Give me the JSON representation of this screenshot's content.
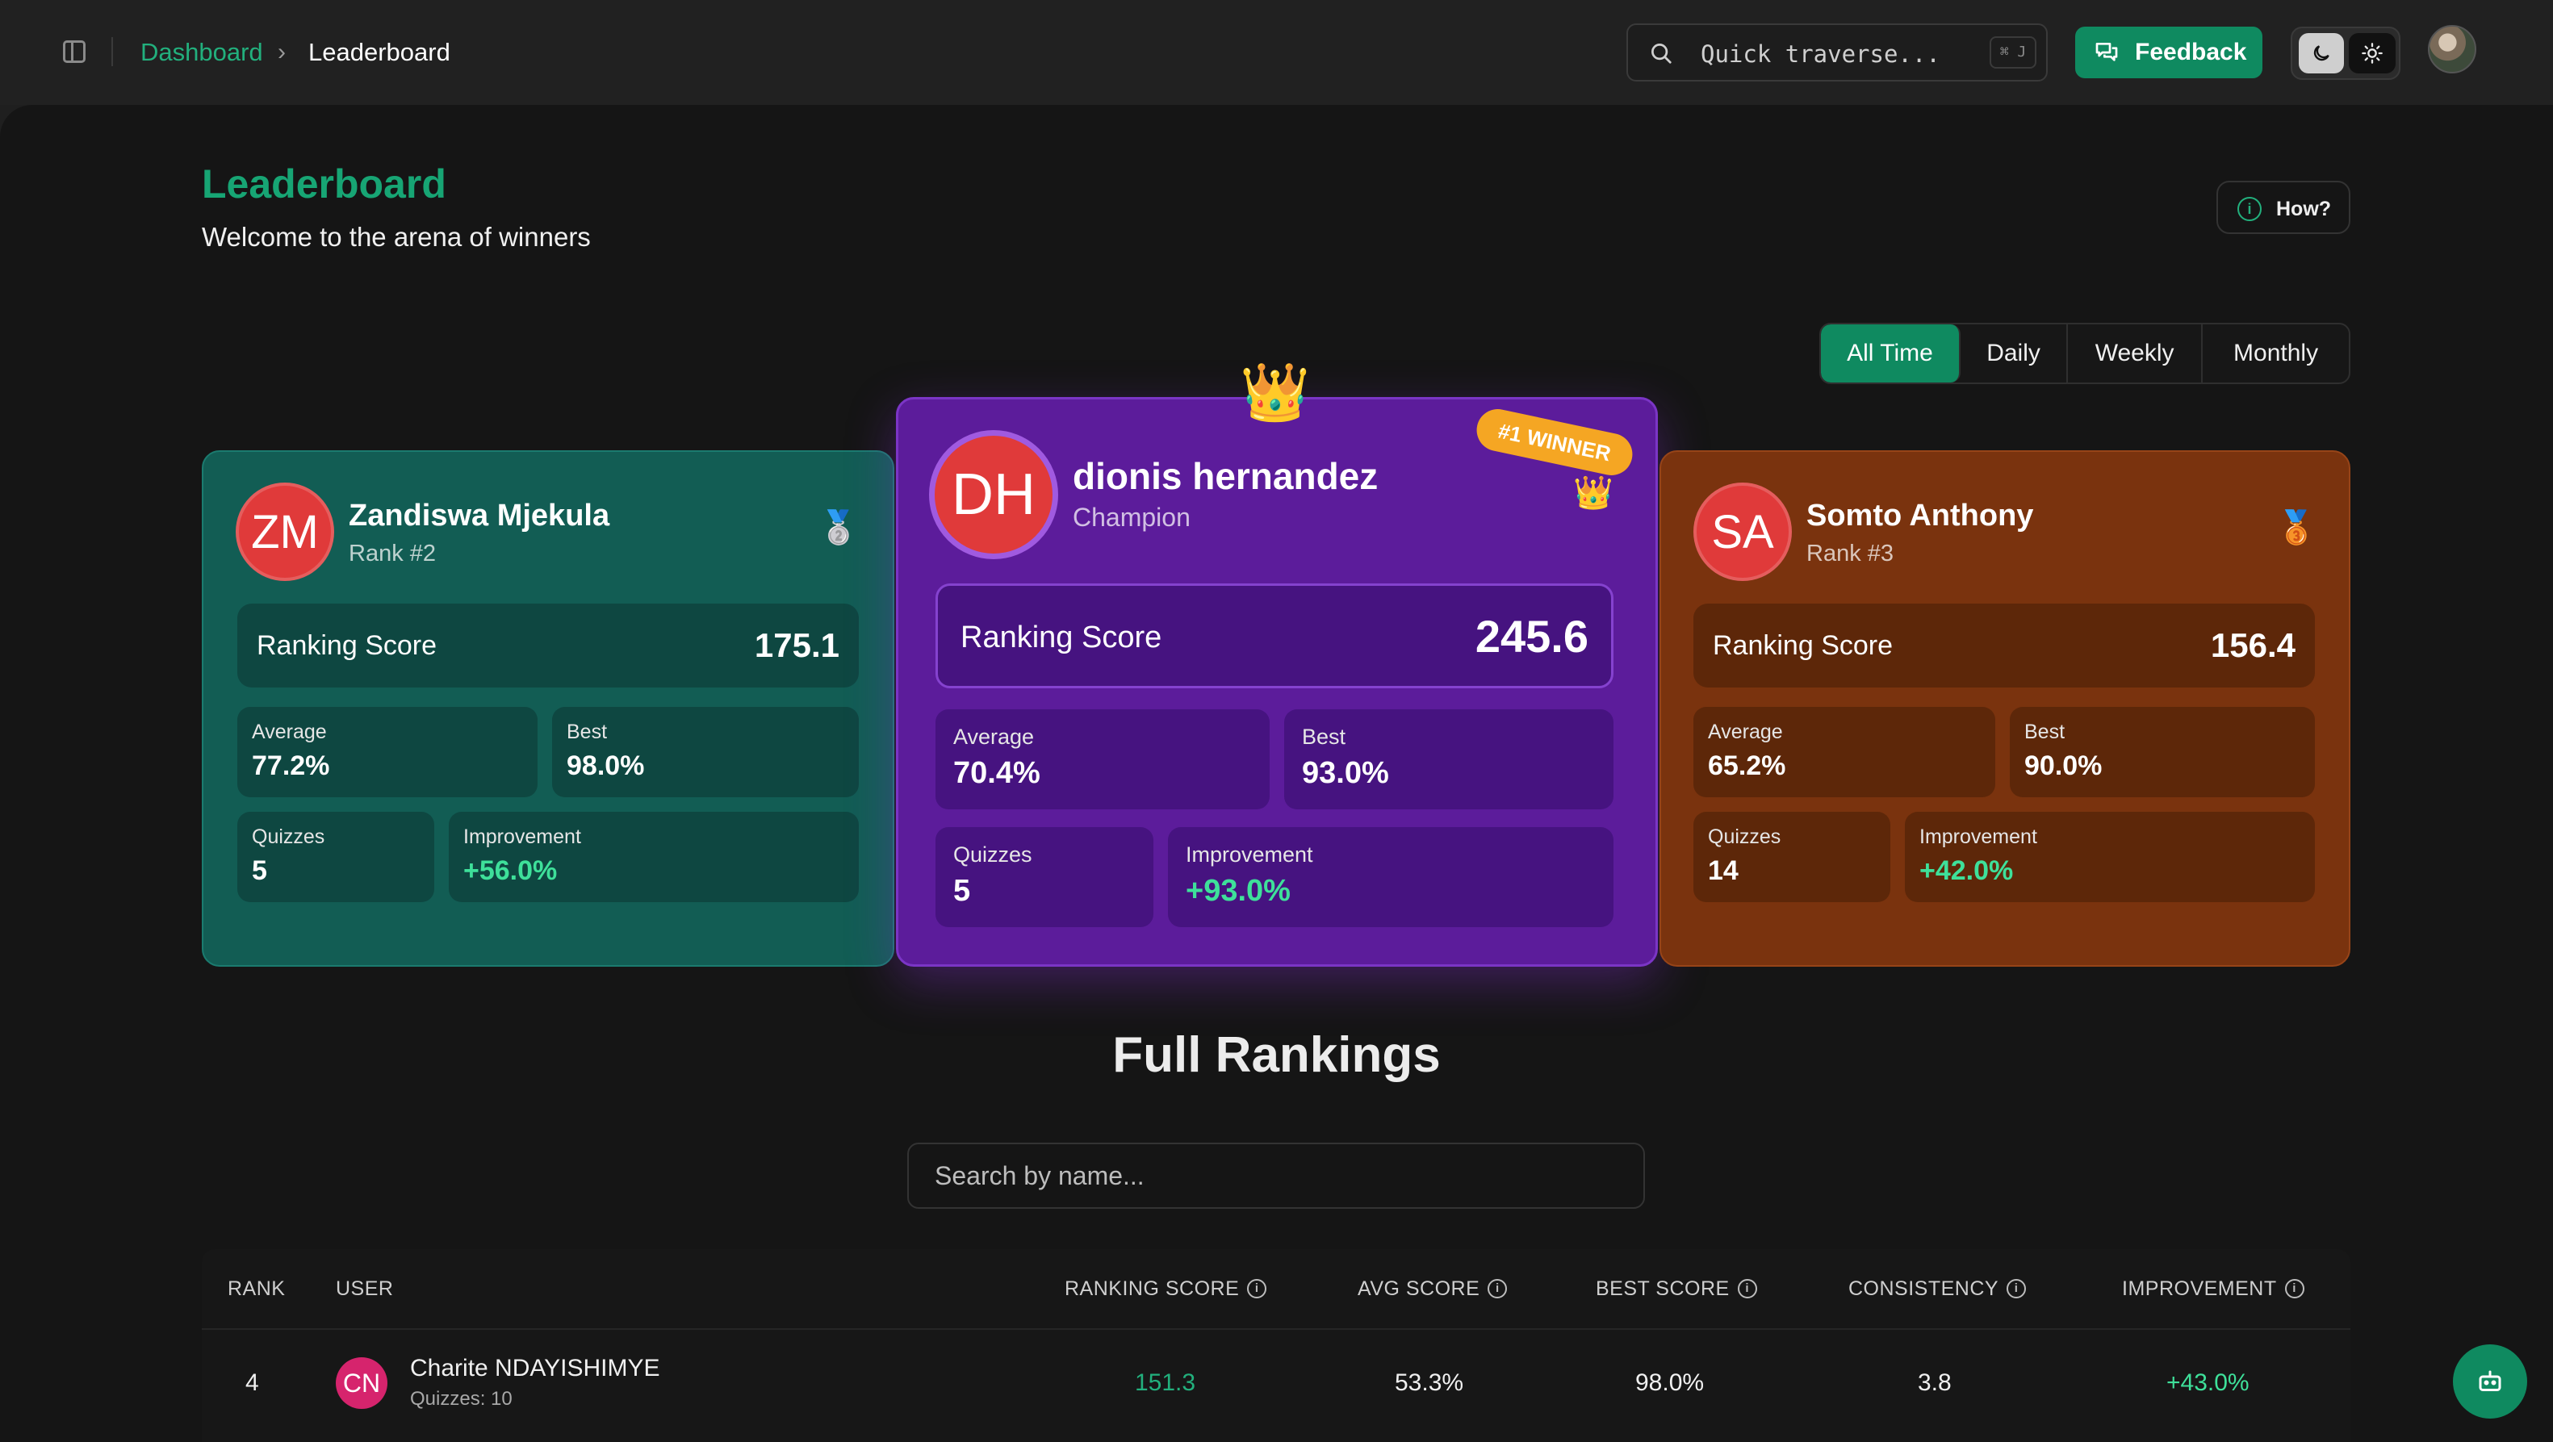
{
  "breadcrumb": {
    "parent": "Dashboard",
    "separator": ">",
    "current": "Leaderboard"
  },
  "search": {
    "placeholder": "Quick traverse...",
    "shortcut": "⌘ J"
  },
  "feedback": {
    "label": "Feedback"
  },
  "page": {
    "title": "Leaderboard",
    "subtitle": "Welcome to the arena of winners",
    "how_label": "How?"
  },
  "periods": [
    "All Time",
    "Daily",
    "Weekly",
    "Monthly"
  ],
  "active_period": "All Time",
  "podium": {
    "first": {
      "initials": "DH",
      "name": "dionis hernandez",
      "subtitle": "Champion",
      "badge": "#1 WINNER",
      "score_label": "Ranking Score",
      "score": "245.6",
      "average_label": "Average",
      "average": "70.4%",
      "best_label": "Best",
      "best": "93.0%",
      "quizzes_label": "Quizzes",
      "quizzes": "5",
      "improvement_label": "Improvement",
      "improvement": "+93.0%"
    },
    "second": {
      "initials": "ZM",
      "name": "Zandiswa Mjekula",
      "subtitle": "Rank #2",
      "score_label": "Ranking Score",
      "score": "175.1",
      "average_label": "Average",
      "average": "77.2%",
      "best_label": "Best",
      "best": "98.0%",
      "quizzes_label": "Quizzes",
      "quizzes": "5",
      "improvement_label": "Improvement",
      "improvement": "+56.0%"
    },
    "third": {
      "initials": "SA",
      "name": "Somto Anthony",
      "subtitle": "Rank #3",
      "score_label": "Ranking Score",
      "score": "156.4",
      "average_label": "Average",
      "average": "65.2%",
      "best_label": "Best",
      "best": "90.0%",
      "quizzes_label": "Quizzes",
      "quizzes": "14",
      "improvement_label": "Improvement",
      "improvement": "+42.0%"
    }
  },
  "rankings": {
    "title": "Full Rankings",
    "search_placeholder": "Search by name...",
    "columns": [
      "RANK",
      "USER",
      "RANKING SCORE",
      "AVG SCORE",
      "BEST SCORE",
      "CONSISTENCY",
      "IMPROVEMENT"
    ],
    "rows": [
      {
        "rank": "4",
        "initials": "CN",
        "name": "Charite NDAYISHIMYE",
        "quizzes": "Quizzes: 10",
        "ranking_score": "151.3",
        "avg_score": "53.3%",
        "best_score": "98.0%",
        "consistency": "3.8",
        "improvement": "+43.0%"
      }
    ]
  },
  "colors": {
    "accent": "#0f8a60",
    "title_green": "#17a574",
    "first_card": "#5c1c9b",
    "second_card": "#125d54",
    "third_card": "#7a330e",
    "improvement_green": "#3ee09a"
  },
  "icons": {
    "sidebar": "sidebar-toggle-icon",
    "search": "search-icon",
    "feedback": "message-icon",
    "moon": "moon-icon",
    "sun": "sun-icon",
    "info": "info-icon",
    "crown": "crown-icon",
    "bot": "bot-icon"
  }
}
